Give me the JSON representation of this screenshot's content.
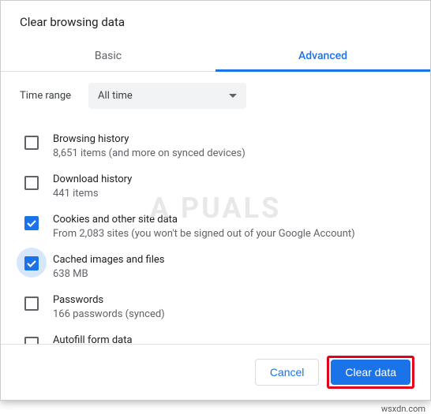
{
  "dialog": {
    "title": "Clear browsing data"
  },
  "tabs": {
    "basic": "Basic",
    "advanced": "Advanced"
  },
  "time": {
    "label": "Time range",
    "value": "All time"
  },
  "items": [
    {
      "label": "Browsing history",
      "sub": "8,651 items (and more on synced devices)",
      "checked": false
    },
    {
      "label": "Download history",
      "sub": "441 items",
      "checked": false
    },
    {
      "label": "Cookies and other site data",
      "sub": "From 2,083 sites (you won't be signed out of your Google Account)",
      "checked": true
    },
    {
      "label": "Cached images and files",
      "sub": "638 MB",
      "checked": true
    },
    {
      "label": "Passwords",
      "sub": "166 passwords (synced)",
      "checked": false
    },
    {
      "label": "Autofill form data",
      "sub": "",
      "checked": false
    }
  ],
  "footer": {
    "cancel": "Cancel",
    "clear": "Clear data"
  },
  "watermark": "A   PUALS",
  "credit": "wsxdn.com"
}
